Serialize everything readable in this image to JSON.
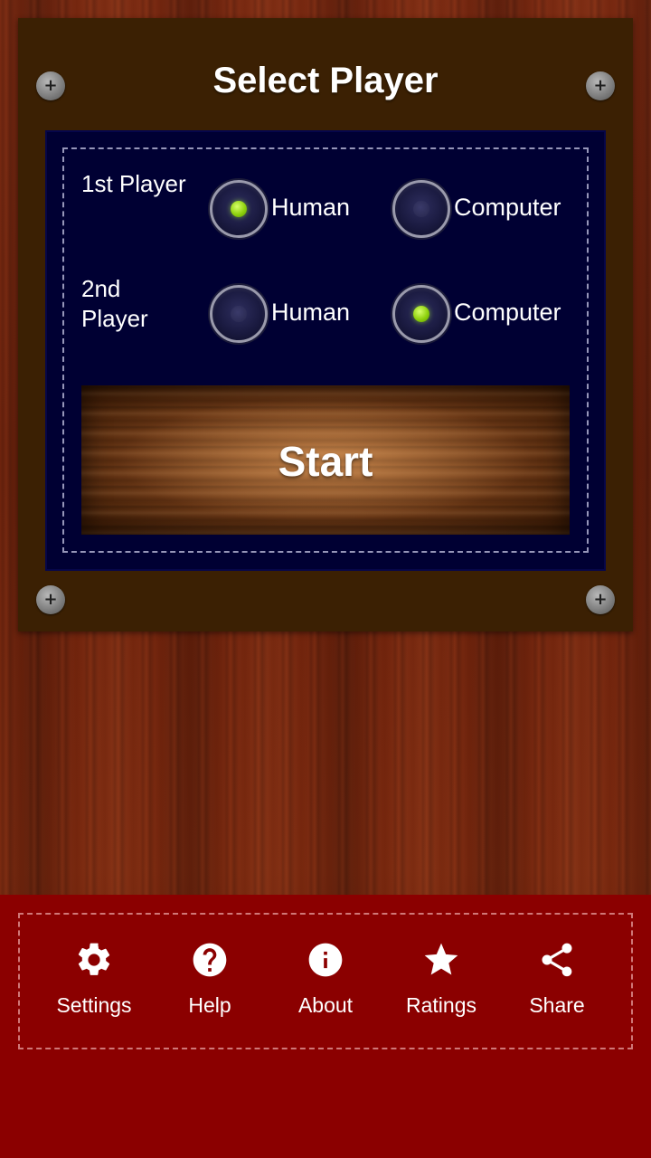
{
  "panel": {
    "title": "Select Player",
    "screw_glyph": "+"
  },
  "players": [
    {
      "label": "1st Player",
      "options": [
        {
          "label": "Human",
          "selected": true
        },
        {
          "label": "Computer",
          "selected": false
        }
      ]
    },
    {
      "label": "2nd Player",
      "options": [
        {
          "label": "Human",
          "selected": false
        },
        {
          "label": "Computer",
          "selected": true
        }
      ]
    }
  ],
  "start": {
    "label": "Start"
  },
  "bottom_nav": [
    {
      "label": "Settings",
      "icon": "gear-icon"
    },
    {
      "label": "Help",
      "icon": "help-icon"
    },
    {
      "label": "About",
      "icon": "info-icon"
    },
    {
      "label": "Ratings",
      "icon": "star-icon"
    },
    {
      "label": "Share",
      "icon": "share-icon"
    }
  ],
  "colors": {
    "panel": "#3b2003",
    "inner_panel": "#000033",
    "bottom_bar": "#8b0000",
    "radio_selected": "#8fd10e",
    "text": "#ffffff"
  }
}
